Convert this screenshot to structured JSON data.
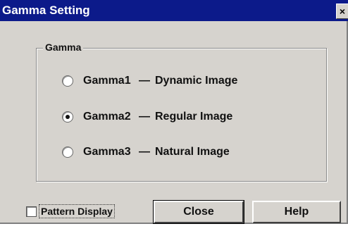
{
  "window": {
    "title": "Gamma Setting",
    "close_glyph": "×"
  },
  "group": {
    "label": "Gamma",
    "options": [
      {
        "name": "Gamma1",
        "separator": "—",
        "description": "Dynamic Image",
        "selected": false
      },
      {
        "name": "Gamma2",
        "separator": "—",
        "description": "Regular Image",
        "selected": true
      },
      {
        "name": "Gamma3",
        "separator": "—",
        "description": "Natural Image",
        "selected": false
      }
    ]
  },
  "pattern_display": {
    "label": "Pattern Display",
    "checked": false
  },
  "buttons": {
    "close_label": "Close",
    "help_label": "Help"
  }
}
